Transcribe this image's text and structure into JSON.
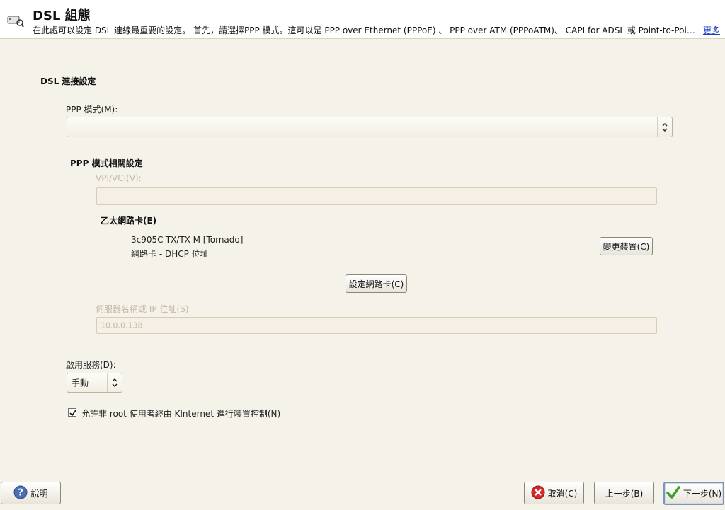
{
  "header": {
    "title": "DSL 組態",
    "description": "在此處可以設定 DSL 連線最重要的設定。 首先，請選擇PPP 模式。這可以是 PPP over Ethernet (PPPoE) 、 PPP over ATM (PPPoATM)、 CAPI for ADSL 或 Point-to-Point Tunneling Protocol (PPTP)。",
    "more_link": "更多"
  },
  "dsl_section": {
    "title": "DSL 連接設定",
    "ppp_mode_label": "PPP 模式(M):",
    "ppp_mode_value": ""
  },
  "ppp_settings": {
    "title": "PPP 模式相關設定",
    "vpi_label": "VPI/VCI(V):",
    "vpi_value": "",
    "ethernet_title": "乙太網路卡(E)",
    "device_name": "3c905C-TX/TX-M [Tornado]",
    "device_desc": "網路卡 - DHCP 位址",
    "change_device_button": "變更裝置(C)",
    "configure_nic_button": "設定網路卡(C)",
    "server_label": "伺服器名稱或 IP 位址(S):",
    "server_value": "10.0.0.138"
  },
  "service": {
    "label": "啟用服務(D):",
    "value": "手動"
  },
  "allow_control": {
    "label": "允許非 root 使用者經由 KInternet 進行裝置控制(N)",
    "checked": true
  },
  "footer": {
    "help_button": "說明",
    "cancel_button": "取消(C)",
    "back_button": "上一步(B)",
    "next_button": "下一步(N)"
  }
}
